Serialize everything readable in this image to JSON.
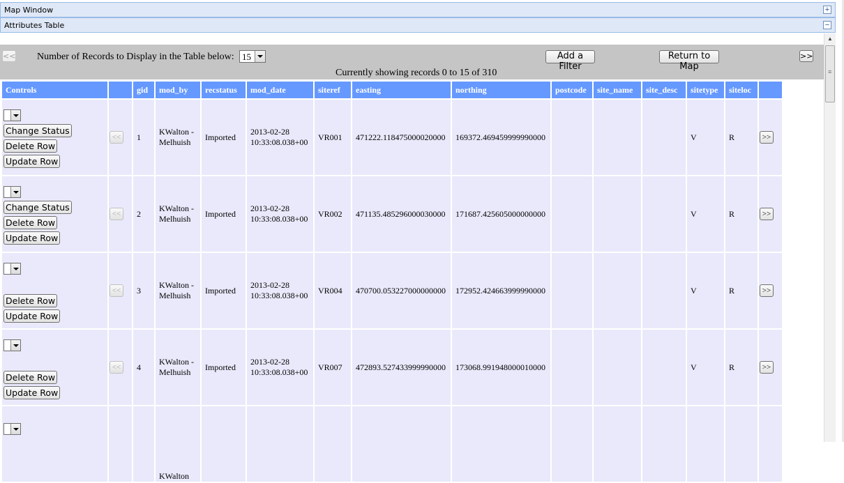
{
  "panels": {
    "map_window": "Map Window",
    "map_window_tool": "+",
    "attributes_table": "Attributes Table",
    "attributes_table_tool": "−"
  },
  "toolbar": {
    "prev_label": "<<",
    "next_label": ">>",
    "records_label": "Number of Records to Display in the Table below:",
    "records_value": "15",
    "add_filter": "Add a Filter",
    "return_map": "Return to Map",
    "showing": "Currently showing records 0 to 15 of 310"
  },
  "table": {
    "headers": [
      "Controls",
      "",
      "gid",
      "mod_by",
      "recstatus",
      "mod_date",
      "siteref",
      "easting",
      "northing",
      "postcode",
      "site_name",
      "site_desc",
      "sitetype",
      "siteloc",
      ""
    ],
    "row_buttons": {
      "change_status": "Change Status",
      "delete_row": "Delete Row",
      "update_row": "Update Row",
      "prev": "<<",
      "next": ">>"
    },
    "rows": [
      {
        "gid": "1",
        "mod_by": "KWalton - Melhuish",
        "recstatus": "Imported",
        "mod_date": "2013-02-28 10:33:08.038+00",
        "siteref": "VR001",
        "easting": "471222.118475000020000",
        "northing": "169372.469459999990000",
        "postcode": "",
        "site_name": "",
        "site_desc": "",
        "sitetype": "V",
        "siteloc": "R",
        "change_status": true
      },
      {
        "gid": "2",
        "mod_by": "KWalton - Melhuish",
        "recstatus": "Imported",
        "mod_date": "2013-02-28 10:33:08.038+00",
        "siteref": "VR002",
        "easting": "471135.485296000030000",
        "northing": "171687.425605000000000",
        "postcode": "",
        "site_name": "",
        "site_desc": "",
        "sitetype": "V",
        "siteloc": "R",
        "change_status": true
      },
      {
        "gid": "3",
        "mod_by": "KWalton - Melhuish",
        "recstatus": "Imported",
        "mod_date": "2013-02-28 10:33:08.038+00",
        "siteref": "VR004",
        "easting": "470700.053227000000000",
        "northing": "172952.424663999990000",
        "postcode": "",
        "site_name": "",
        "site_desc": "",
        "sitetype": "V",
        "siteloc": "R",
        "change_status": false
      },
      {
        "gid": "4",
        "mod_by": "KWalton - Melhuish",
        "recstatus": "Imported",
        "mod_date": "2013-02-28 10:33:08.038+00",
        "siteref": "VR007",
        "easting": "472893.527433999990000",
        "northing": "173068.991948000010000",
        "postcode": "",
        "site_name": "",
        "site_desc": "",
        "sitetype": "V",
        "siteloc": "R",
        "change_status": false
      },
      {
        "gid": "",
        "mod_by": "KWalton",
        "recstatus": "",
        "mod_date": "",
        "siteref": "",
        "easting": "",
        "northing": "",
        "postcode": "",
        "site_name": "",
        "site_desc": "",
        "sitetype": "",
        "siteloc": "",
        "change_status": false,
        "partial": true
      }
    ]
  },
  "colors": {
    "header_bg": "#6699ff",
    "cell_bg": "#e9e9fb",
    "toolbar_bg": "#c5c5c5",
    "panel_bg": "#dfe8f6"
  },
  "icons": {
    "expand": "plus-icon",
    "collapse": "minus-icon",
    "dropdown": "chevron-down-icon"
  }
}
